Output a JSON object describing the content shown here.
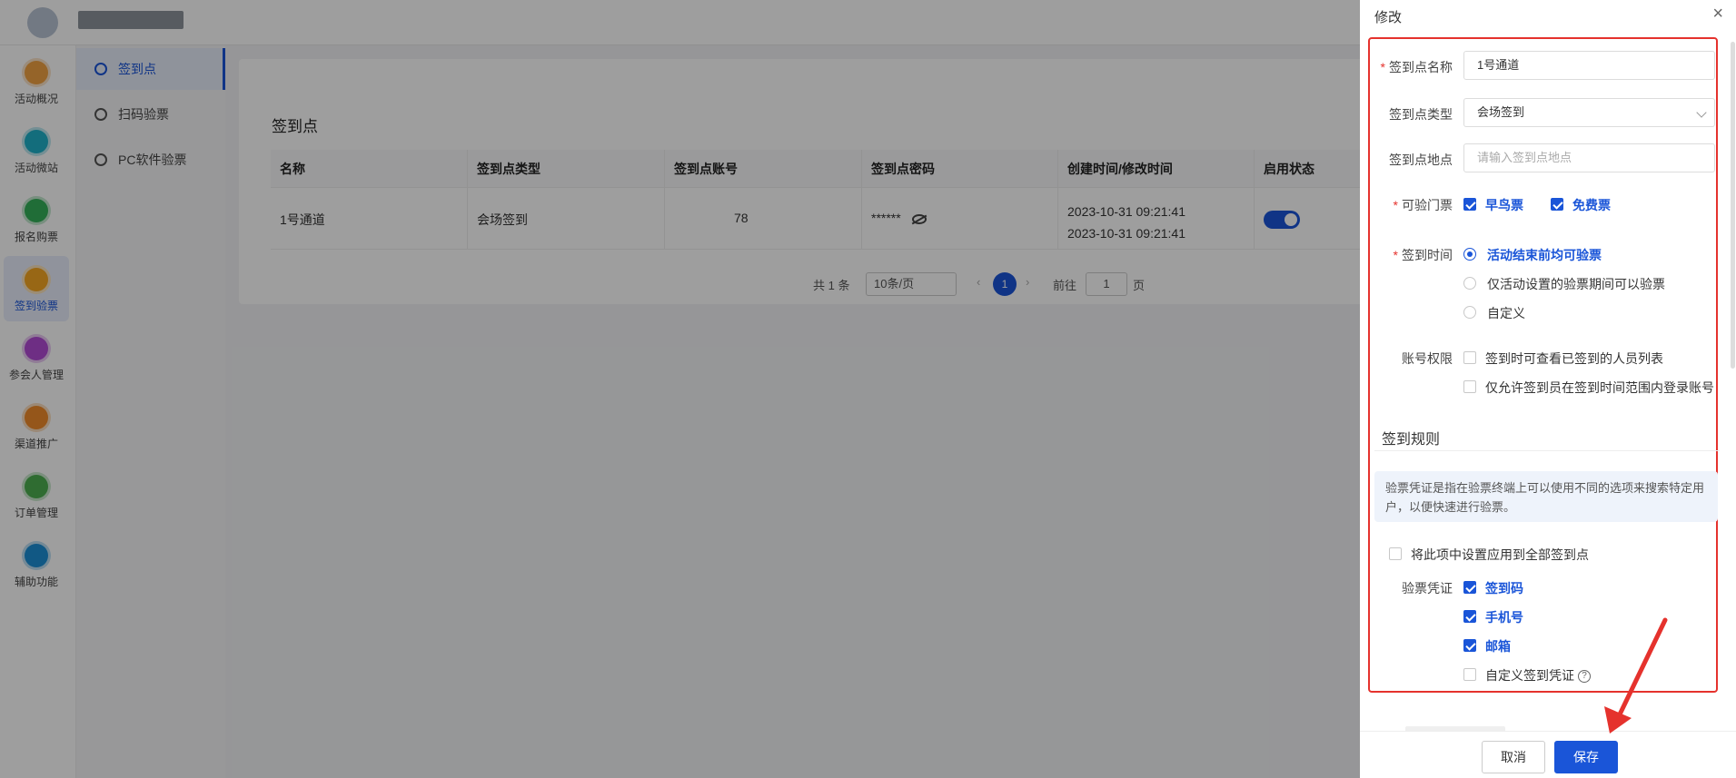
{
  "leftnav": {
    "items": [
      {
        "label": "活动概况",
        "icon": "dashboard-icon",
        "color": "#f0a243"
      },
      {
        "label": "活动微站",
        "icon": "microsite-icon",
        "color": "#1fb0c8"
      },
      {
        "label": "报名购票",
        "icon": "ticket-icon",
        "color": "#35b05a"
      },
      {
        "label": "签到验票",
        "icon": "checkin-icon",
        "color": "#f5a623",
        "active": true
      },
      {
        "label": "参会人管理",
        "icon": "attendee-icon",
        "color": "#b24bd6"
      },
      {
        "label": "渠道推广",
        "icon": "channel-icon",
        "color": "#f08c2a"
      },
      {
        "label": "订单管理",
        "icon": "order-icon",
        "color": "#4caf50"
      },
      {
        "label": "辅助功能",
        "icon": "tools-icon",
        "color": "#1c8fd6"
      }
    ]
  },
  "subnav": {
    "items": [
      {
        "label": "签到点",
        "active": true
      },
      {
        "label": "扫码验票"
      },
      {
        "label": "PC软件验票"
      }
    ]
  },
  "main": {
    "title": "签到点",
    "columns": [
      "名称",
      "签到点类型",
      "签到点账号",
      "签到点密码",
      "创建时间/修改时间",
      "启用状态"
    ],
    "row": {
      "name": "1号通道",
      "type": "会场签到",
      "account": "78",
      "password": "******",
      "created": "2023-10-31 09:21:41",
      "modified": "2023-10-31 09:21:41",
      "enabled": true
    },
    "pagination": {
      "total": "共 1 条",
      "page_size": "10条/页",
      "current_page": "1",
      "goto_label": "前往",
      "goto_value": "1",
      "page_suffix": "页"
    }
  },
  "drawer": {
    "title": "修改",
    "fields": {
      "name_label": "签到点名称",
      "name_value": "1号通道",
      "type_label": "签到点类型",
      "type_value": "会场签到",
      "location_label": "签到点地点",
      "location_placeholder": "请输入签到点地点",
      "tickets_label": "可验门票",
      "ticket_options": [
        {
          "label": "早鸟票",
          "checked": true
        },
        {
          "label": "免费票",
          "checked": true
        }
      ],
      "time_label": "签到时间",
      "time_options": [
        {
          "label": "活动结束前均可验票",
          "selected": true
        },
        {
          "label": "仅活动设置的验票期间可以验票",
          "selected": false
        },
        {
          "label": "自定义",
          "selected": false
        }
      ],
      "perm_label": "账号权限",
      "perm_options": [
        {
          "label": "签到时可查看已签到的人员列表",
          "checked": false
        },
        {
          "label": "仅允许签到员在签到时间范围内登录账号",
          "checked": false
        }
      ]
    },
    "rules": {
      "section_title": "签到规则",
      "info": "验票凭证是指在验票终端上可以使用不同的选项来搜索特定用户，以便快速进行验票。",
      "apply_all": "将此项中设置应用到全部签到点",
      "credential_label": "验票凭证",
      "credentials": [
        {
          "label": "签到码",
          "checked": true
        },
        {
          "label": "手机号",
          "checked": true
        },
        {
          "label": "邮箱",
          "checked": true
        },
        {
          "label": "自定义签到凭证",
          "checked": false
        }
      ]
    },
    "footer": {
      "cancel": "取消",
      "save": "保存"
    }
  },
  "colors": {
    "accent": "#1a55d8",
    "highlight": "#e5322d"
  }
}
